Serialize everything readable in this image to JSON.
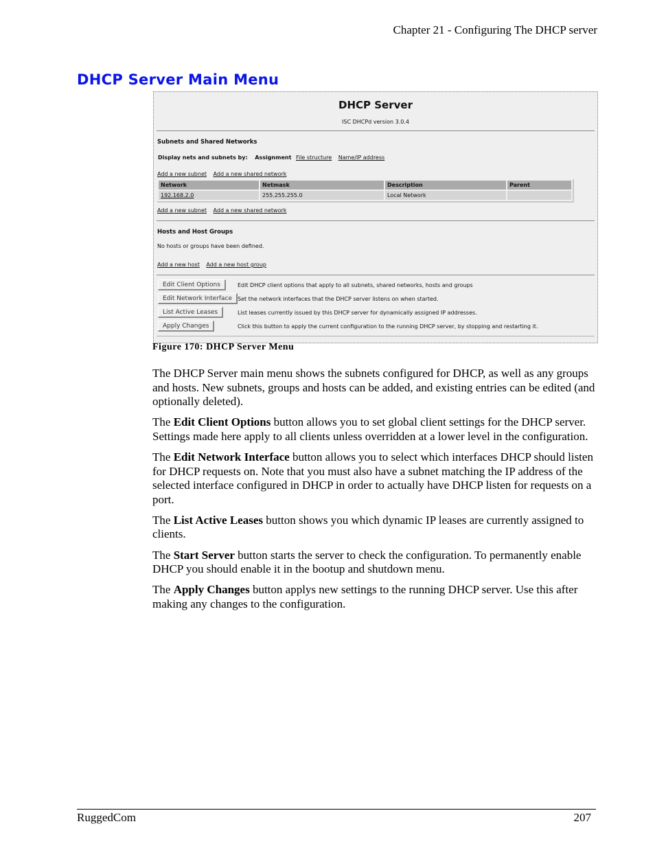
{
  "running_header": "Chapter 21 - Configuring The DHCP server",
  "section_title": "DHCP Server Main Menu",
  "screenshot": {
    "app_title": "DHCP Server",
    "version": "ISC DHCPd version 3.0.4",
    "subnets_section": {
      "heading": "Subnets and Shared Networks",
      "display_by_label": "Display nets and subnets by:",
      "display_by_current": "Assignment",
      "display_by_links": [
        "File structure",
        "Name/IP address"
      ],
      "top_links": [
        "Add a new subnet",
        "Add a new shared network"
      ],
      "table": {
        "columns": [
          "Network",
          "Netmask",
          "Description",
          "Parent"
        ],
        "rows": [
          [
            "192.168.2.0",
            "255.255.255.0",
            "Local Network",
            ""
          ]
        ]
      },
      "bottom_links": [
        "Add a new subnet",
        "Add a new shared network"
      ]
    },
    "hosts_section": {
      "heading": "Hosts and Host Groups",
      "empty_message": "No hosts or groups have been defined.",
      "links": [
        "Add a new host",
        "Add a new host group"
      ]
    },
    "actions": [
      {
        "label": "Edit Client Options",
        "description": "Edit DHCP client options that apply to all subnets, shared networks, hosts and groups"
      },
      {
        "label": "Edit Network Interface",
        "description": "Set the network interfaces that the DHCP server listens on when started."
      },
      {
        "label": "List Active Leases",
        "description": "List leases currently issued by this DHCP server for dynamically assigned IP addresses."
      },
      {
        "label": "Apply Changes",
        "description": "Click this button to apply the current configuration to the running DHCP server, by stopping and restarting it."
      }
    ]
  },
  "caption": "Figure 170: DHCP Server Menu",
  "paragraphs": [
    {
      "prefix": "The DHCP Server main menu shows the subnets configured for DHCP, as well as any groups and hosts.  New subnets, groups and hosts can be added, and existing entries can be edited (and optionally deleted).",
      "bold": "",
      "suffix": ""
    },
    {
      "prefix": "The ",
      "bold": "Edit Client Options",
      "suffix": " button allows you to set global client settings for the DHCP server.  Settings made here apply to all clients unless overridden at a lower level in the configuration."
    },
    {
      "prefix": "The ",
      "bold": "Edit Network Interface",
      "suffix": " button allows you to select which interfaces DHCP should listen for DHCP requests on.  Note that you must also have a subnet matching the IP address of the selected interface configured in DHCP in order to actually have DHCP listen for requests on a port."
    },
    {
      "prefix": "The ",
      "bold": "List Active Leases",
      "suffix": " button shows you which dynamic IP leases are currently assigned to clients."
    },
    {
      "prefix": "The ",
      "bold": "Start Server",
      "suffix": " button starts the server to check the configuration.  To permanently enable DHCP you should enable it in the bootup and shutdown menu."
    },
    {
      "prefix": "The ",
      "bold": "Apply Changes",
      "suffix": " button applys new settings to the running DHCP server.  Use this after making any changes to the configuration."
    }
  ],
  "footer": {
    "left": "RuggedCom",
    "page_number": "207"
  }
}
